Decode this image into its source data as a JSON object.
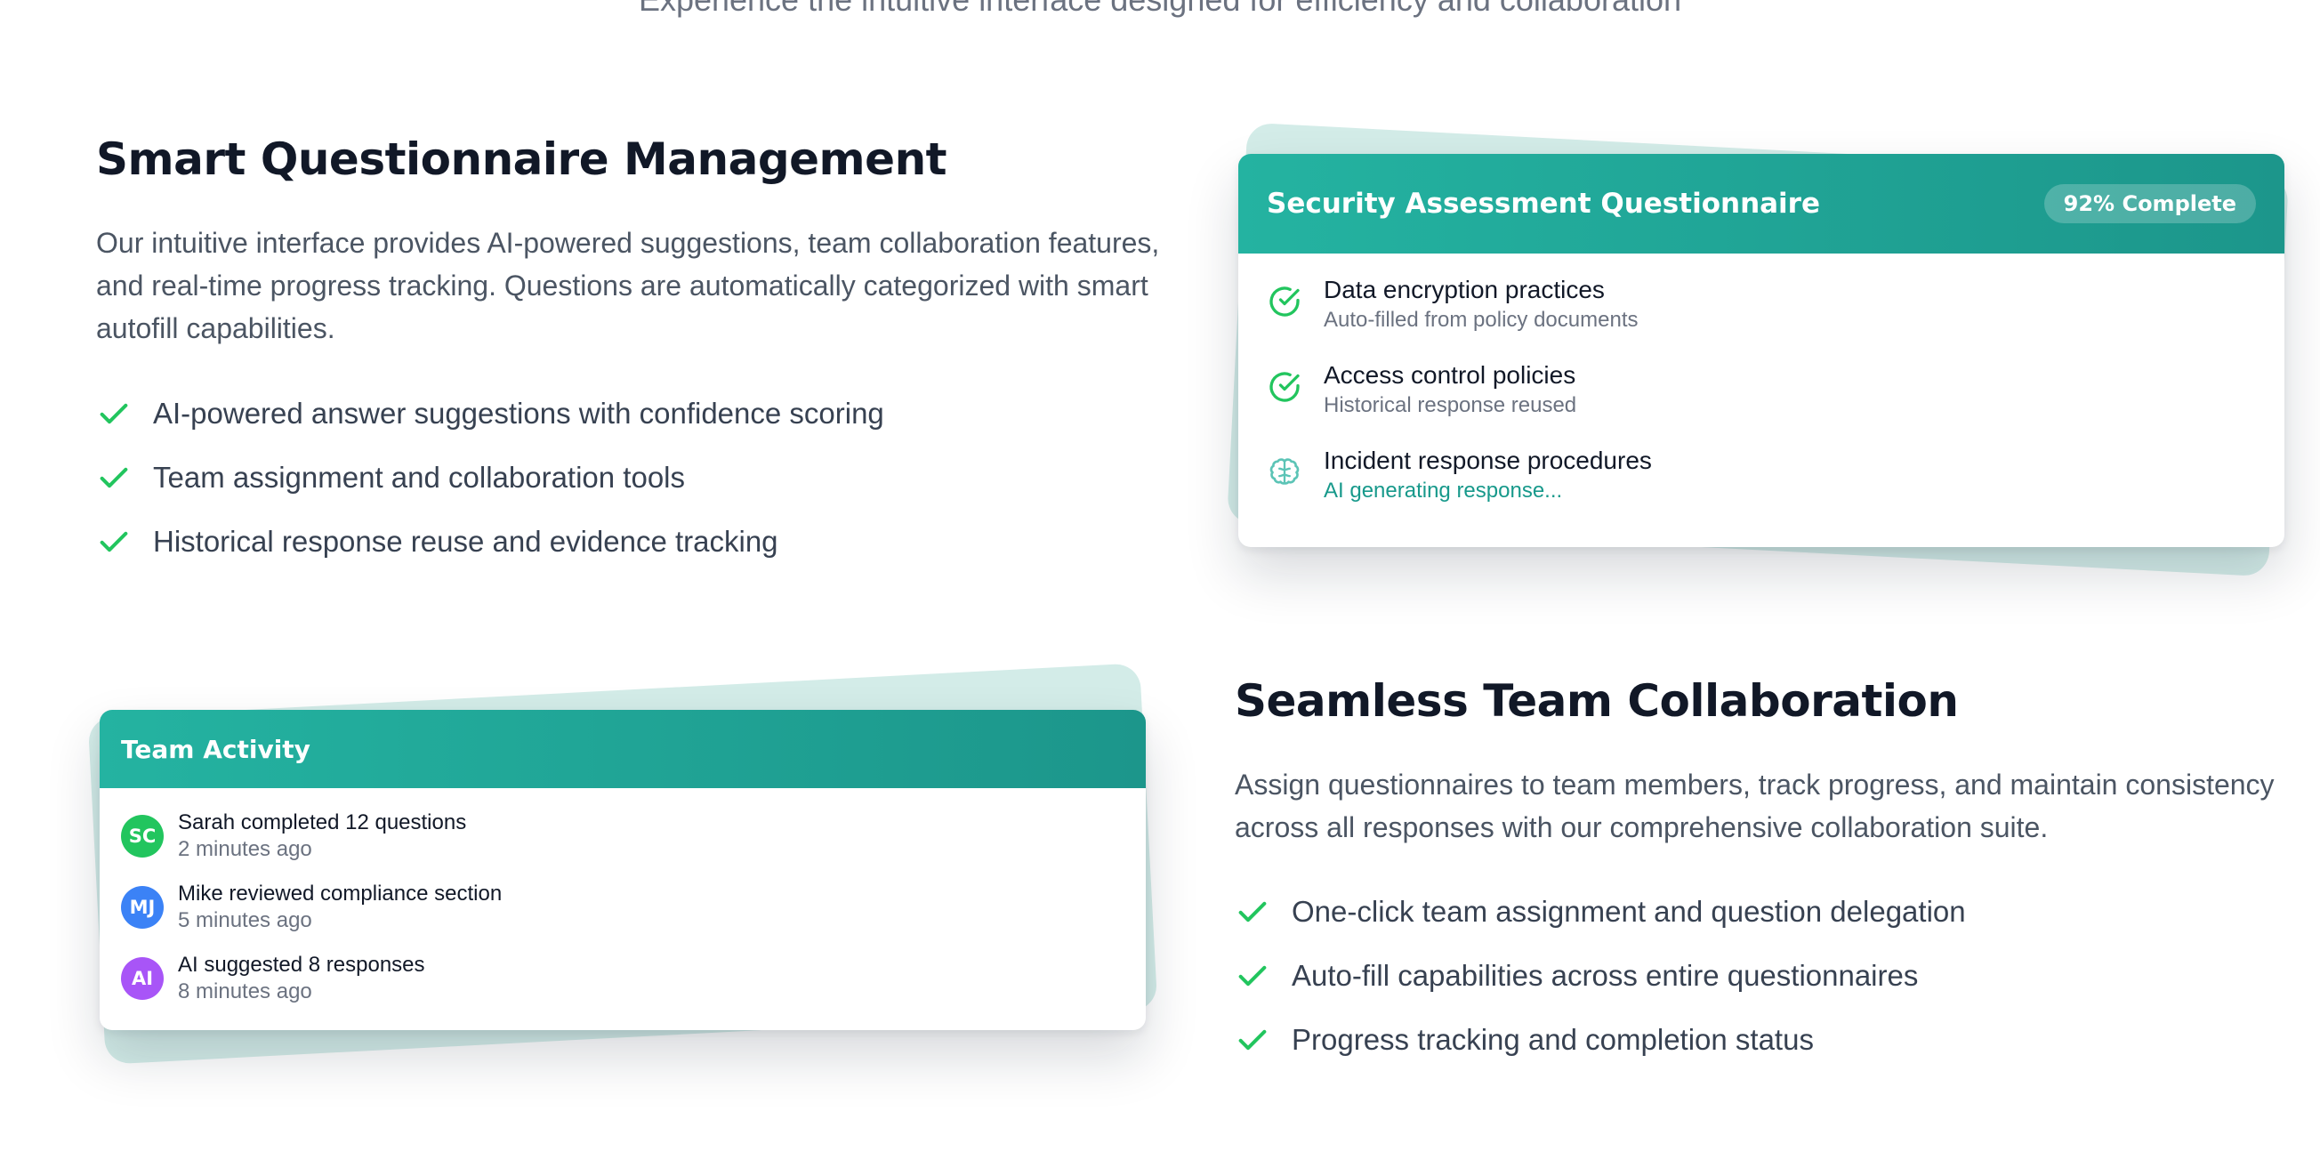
{
  "header": {
    "subtitle": "Experience the intuitive interface designed for efficiency and collaboration"
  },
  "section_questionnaire": {
    "title": "Smart Questionnaire Management",
    "description": "Our intuitive interface provides AI-powered suggestions, team collaboration features, and real-time progress tracking. Questions are automatically categorized with smart autofill capabilities.",
    "features": [
      "AI-powered answer suggestions with confidence scoring",
      "Team assignment and collaboration tools",
      "Historical response reuse and evidence tracking"
    ]
  },
  "questionnaire_card": {
    "title": "Security Assessment Questionnaire",
    "badge": "92% Complete",
    "items": [
      {
        "title": "Data encryption practices",
        "subtitle": "Auto-filled from policy documents",
        "icon": "check-circle-icon"
      },
      {
        "title": "Access control policies",
        "subtitle": "Historical response reused",
        "icon": "check-circle-icon"
      },
      {
        "title": "Incident response procedures",
        "subtitle": "AI generating response...",
        "icon": "brain-icon"
      }
    ]
  },
  "activity_card": {
    "title": "Team Activity",
    "items": [
      {
        "initials": "SC",
        "text": "Sarah completed 12 questions",
        "time": "2 minutes ago",
        "color": "#22c55e"
      },
      {
        "initials": "MJ",
        "text": "Mike reviewed compliance section",
        "time": "5 minutes ago",
        "color": "#3b82f6"
      },
      {
        "initials": "AI",
        "text": "AI suggested 8 responses",
        "time": "8 minutes ago",
        "color": "#a855f7"
      }
    ]
  },
  "section_collaboration": {
    "title": "Seamless Team Collaboration",
    "description": "Assign questionnaires to team members, track progress, and maintain consistency across all responses with our comprehensive collaboration suite.",
    "features": [
      "One-click team assignment and question delegation",
      "Auto-fill capabilities across entire questionnaires",
      "Progress tracking and completion status"
    ]
  },
  "colors": {
    "accent": "#1fa898",
    "check": "#22c55e",
    "heading": "#111827",
    "body_text": "#4b5563"
  }
}
